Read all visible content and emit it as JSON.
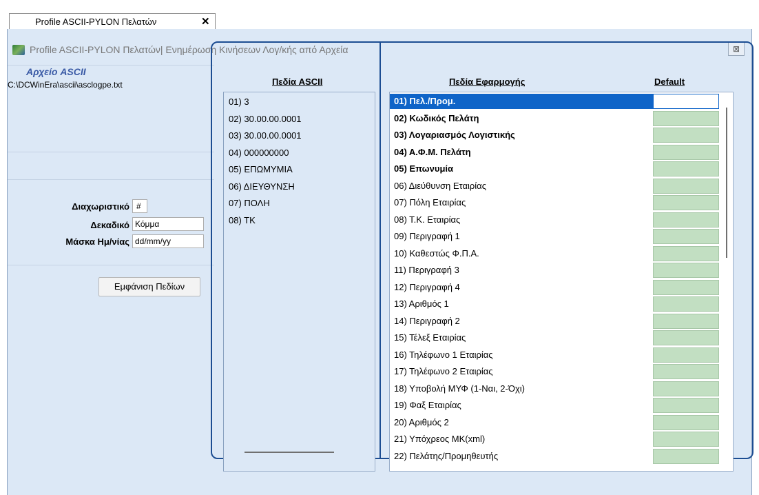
{
  "tab": {
    "label": "Profile ASCII-PYLON Πελατών",
    "close_glyph": "✕"
  },
  "window": {
    "title": "Profile ASCII-PYLON Πελατών| Ενημέρωση Κινήσεων Λογ/κής από Αρχεία",
    "close_glyph": "⊠"
  },
  "left": {
    "file_title": "Αρχείο ASCII",
    "file_path": "C:\\DCWinEra\\ascii\\asclogpe.txt",
    "separator_label": "Διαχωριστικό",
    "separator_value": "#",
    "decimal_label": "Δεκαδικό",
    "decimal_value": "Κόμμα",
    "date_mask_label": "Μάσκα Ημ/νίας",
    "date_mask_value": "dd/mm/yy",
    "show_fields_button": "Εμφάνιση Πεδίων"
  },
  "ascii": {
    "header": "Πεδία ASCII",
    "items": [
      "01) 3",
      "02) 30.00.00.0001",
      "03) 30.00.00.0001",
      "04) 000000000",
      "05) ΕΠΩΜΥΜΙΑ",
      "06) ΔΙΕΥΘΥΝΣΗ",
      "07) ΠΟΛΗ",
      "08) ΤΚ"
    ]
  },
  "app": {
    "header": "Πεδία Εφαρμογής",
    "default_header": "Default",
    "items": [
      "01) Πελ./Προμ.",
      "02) Κωδικός Πελάτη",
      "03) Λογαριασμός Λογιστικής",
      "04) Α.Φ.Μ. Πελάτη",
      "05) Επωνυμία",
      "06) Διεύθυνση Εταιρίας",
      "07) Πόλη  Εταιρίας",
      "08) Τ.Κ. Εταιρίας",
      "09) Περιγραφή 1",
      "10) Καθεστώς Φ.Π.Α.",
      "11) Περιγραφή 3",
      "12) Περιγραφή 4",
      "13) Αριθμός 1",
      "14) Περιγραφή 2",
      "15) Τέλεξ Εταιρίας",
      "16) Τηλέφωνο 1 Εταιρίας",
      "17) Τηλέφωνο 2 Εταιρίας",
      "18) Υποβολή ΜΥΦ (1-Ναι, 2-Όχι)",
      "19) Φαξ Εταιρίας",
      "20) Αριθμός 2",
      "21) Υπόχρεος ΜΚ(xml)",
      "22) Πελάτης/Προμηθευτής"
    ],
    "bold_indices": [
      0,
      1,
      2,
      3,
      4
    ],
    "selected_index": 0
  },
  "colors": {
    "panel_bg": "#dce8f6",
    "frame": "#1c4d92",
    "selection": "#0f64c8",
    "default_cell": "#c2dfc2",
    "file_title": "#3959a5"
  }
}
